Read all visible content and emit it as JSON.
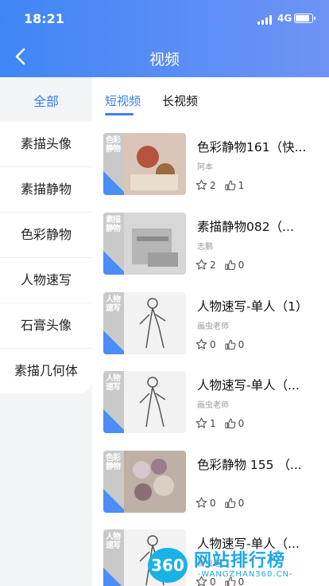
{
  "status_bar": {
    "time": "18:21",
    "network": "4G"
  },
  "header": {
    "title": "视频"
  },
  "sidebar": {
    "all_label": "全部",
    "items": [
      {
        "label": "素描头像"
      },
      {
        "label": "素描静物"
      },
      {
        "label": "色彩静物"
      },
      {
        "label": "人物速写"
      },
      {
        "label": "石膏头像"
      },
      {
        "label": "素描几何体"
      }
    ]
  },
  "tabs": [
    {
      "label": "短视频",
      "active": true
    },
    {
      "label": "长视频",
      "active": false
    }
  ],
  "videos": [
    {
      "title": "色彩静物161（快...",
      "author": "阿本",
      "stars": "2",
      "likes": "1",
      "thumb_label": "色彩静物",
      "thumb_color": "color"
    },
    {
      "title": "素描静物082（...",
      "author": "志鹏",
      "stars": "2",
      "likes": "0",
      "thumb_label": "素描静物",
      "thumb_color": "gray"
    },
    {
      "title": "人物速写-单人（1）",
      "author": "画虫老师",
      "stars": "0",
      "likes": "0",
      "thumb_label": "人物速写",
      "thumb_color": "sketch"
    },
    {
      "title": "人物速写-单人（...",
      "author": "画虫老师",
      "stars": "1",
      "likes": "0",
      "thumb_label": "人物速写",
      "thumb_color": "sketch"
    },
    {
      "title": "色彩静物 155 （...",
      "author": "",
      "stars": "0",
      "likes": "0",
      "thumb_label": "色彩静物",
      "thumb_color": "flower"
    },
    {
      "title": "人物速写-单人（...",
      "author": "画虫老...",
      "stars": "0",
      "likes": "0",
      "thumb_label": "人物速写",
      "thumb_color": "sketch"
    }
  ],
  "watermark": {
    "badge": "360",
    "text": "网站排行榜",
    "url": "-WANGZHAN360.CN-"
  },
  "colors": {
    "accent": "#3a7ef4",
    "header_start": "#3f86f5",
    "header_end": "#6f93f6"
  }
}
